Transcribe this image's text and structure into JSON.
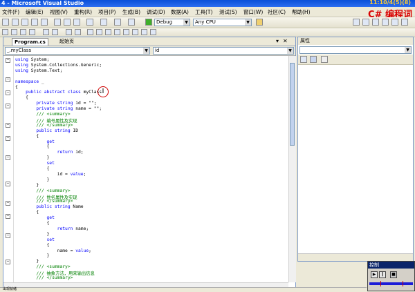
{
  "window": {
    "title": "4 - Microsoft Visual Studio",
    "clock": "11:10/4(5)(8)",
    "brand": "C# 编程词"
  },
  "menu": [
    "文件(F)",
    "编辑(E)",
    "视图(V)",
    "重构(R)",
    "项目(P)",
    "生成(B)",
    "调试(D)",
    "数据(A)",
    "工具(T)",
    "测试(S)",
    "窗口(W)",
    "社区(C)",
    "帮助(H)"
  ],
  "toolbar": {
    "config": "Debug",
    "platform": "Any CPU"
  },
  "editor": {
    "tabs": [
      {
        "label": "Program.cs",
        "active": true
      },
      {
        "label": "起始页",
        "active": false
      }
    ],
    "nav_left": "_.myClass",
    "nav_right": "id",
    "lines": [
      "using System;",
      "using System.Collections.Generic;",
      "using System.Text;",
      "",
      "namespace _",
      "{",
      "    public abstract class myClass",
      "    {",
      "        private string id = \"\";",
      "        private string name = \"\";",
      "        /// <summary>",
      "        /// 编号属性及实现",
      "        /// </summary>",
      "        public string ID",
      "        {",
      "            get",
      "            {",
      "                return id;",
      "            }",
      "            set",
      "            {",
      "                id = value;",
      "            }",
      "        }",
      "        /// <summary>",
      "        /// 姓名属性及实现",
      "        /// </summary>",
      "        public string Name",
      "        {",
      "            get",
      "            {",
      "                return name;",
      "            }",
      "            set",
      "            {",
      "                name = value;",
      "            }",
      "        }",
      "        /// <summary>",
      "        /// 抽象方法，用来输出信息",
      "        /// </summary>"
    ]
  },
  "properties": {
    "title": "属性"
  },
  "player": {
    "title": "控制"
  },
  "status": {
    "text": "出现就绪"
  }
}
